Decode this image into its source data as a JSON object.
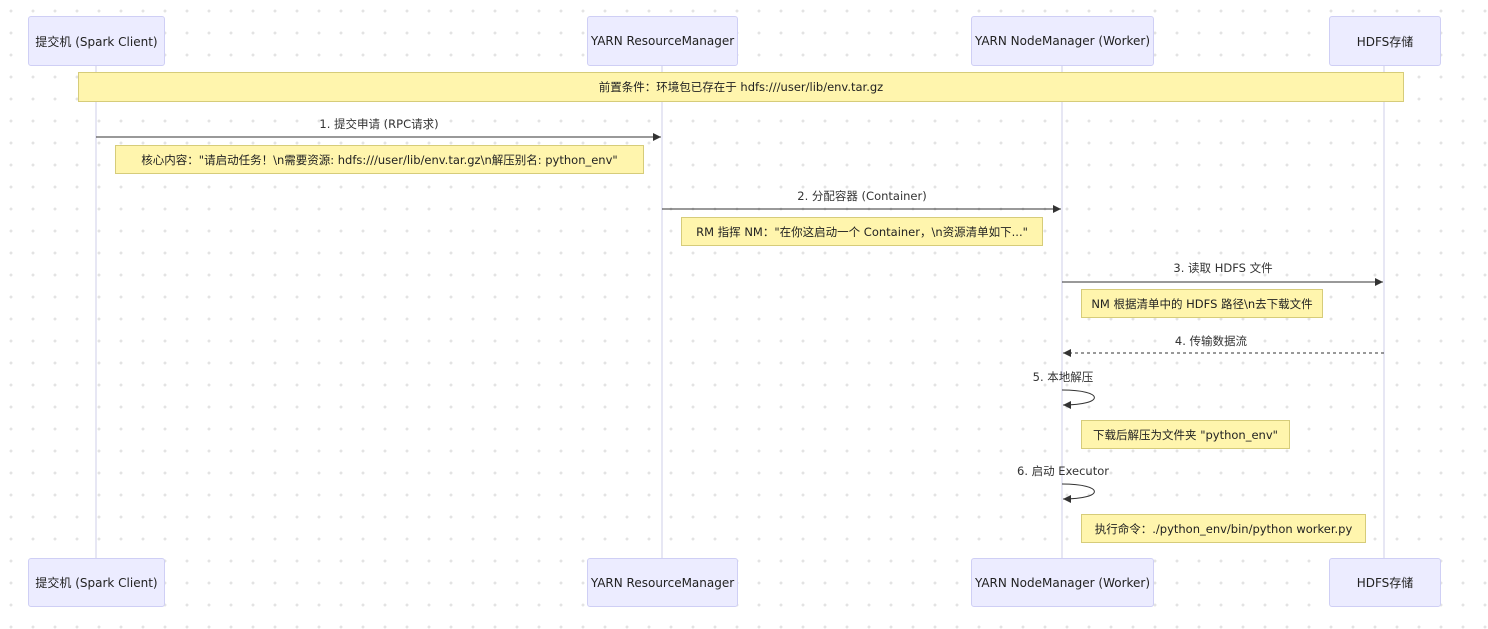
{
  "participants": [
    {
      "id": "client",
      "label": "提交机 (Spark Client)"
    },
    {
      "id": "rm",
      "label": "YARN ResourceManager"
    },
    {
      "id": "nm",
      "label": "YARN NodeManager (Worker)"
    },
    {
      "id": "hdfs",
      "label": "HDFS存储"
    }
  ],
  "precondition": "前置条件：环境包已存在于 hdfs:///user/lib/env.tar.gz",
  "messages": [
    {
      "label": "1. 提交申请 (RPC请求)",
      "from": "client",
      "to": "rm",
      "style": "solid"
    },
    {
      "label": "2. 分配容器 (Container)",
      "from": "rm",
      "to": "nm",
      "style": "solid"
    },
    {
      "label": "3. 读取 HDFS 文件",
      "from": "nm",
      "to": "hdfs",
      "style": "solid"
    },
    {
      "label": "4. 传输数据流",
      "from": "hdfs",
      "to": "nm",
      "style": "dashed"
    },
    {
      "label": "5. 本地解压",
      "from": "nm",
      "to": "nm",
      "style": "solid"
    },
    {
      "label": "6. 启动 Executor",
      "from": "nm",
      "to": "nm",
      "style": "solid"
    }
  ],
  "notes": [
    "核心内容：\"请启动任务！\\n需要资源: hdfs:///user/lib/env.tar.gz\\n解压别名: python_env\"",
    "RM 指挥 NM：\"在你这启动一个 Container，\\n资源清单如下...\"",
    "NM 根据清单中的 HDFS 路径\\n去下载文件",
    "下载后解压为文件夹 \"python_env\"",
    "执行命令：./python_env/bin/python worker.py"
  ],
  "colors": {
    "actor_fill": "#ececff",
    "actor_border": "#cfcff5",
    "note_fill": "#fff5ad",
    "note_border": "#d6cc7a",
    "lifeline": "#cfcfe8",
    "arrow": "#333333"
  }
}
